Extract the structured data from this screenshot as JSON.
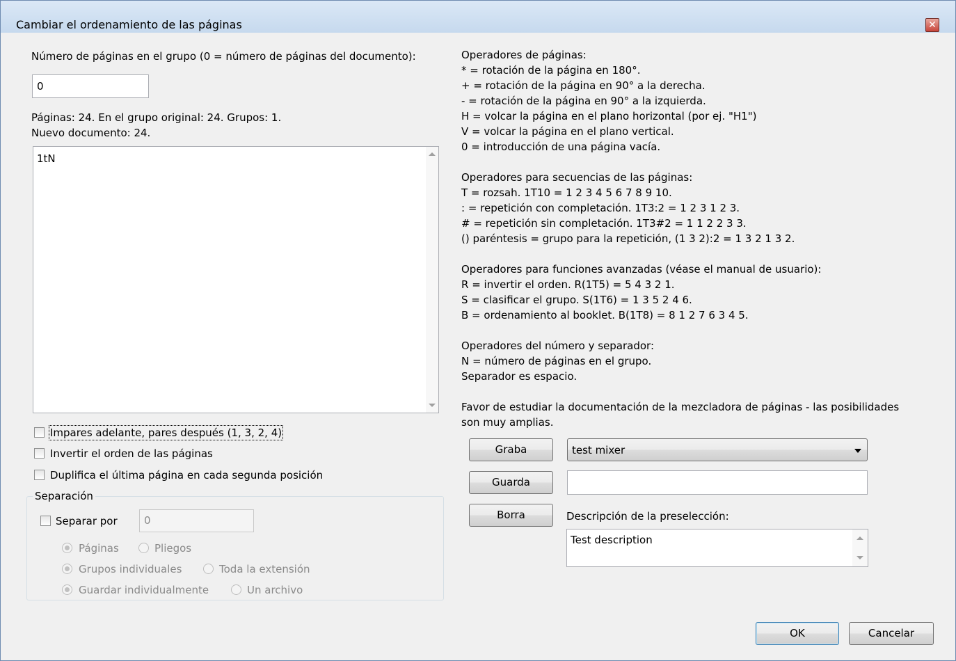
{
  "window": {
    "title": "Cambiar el ordenamiento de las páginas",
    "close_symbol": "✕"
  },
  "left": {
    "group_count_label": "Número de páginas en el grupo (0 = número de páginas del documento):",
    "group_count_value": "0",
    "stats_line1": "Páginas: 24. En el grupo original: 24. Grupos: 1.",
    "stats_line2": "Nuevo documento: 24.",
    "formula_value": "1tN",
    "checkbox_odd_even": "Impares adelante, pares después (1, 3, 2, 4)",
    "checkbox_reverse": "Invertir el orden de las páginas",
    "checkbox_duplicate": "Duplifica el última página en cada segunda posición",
    "separation": {
      "group_title": "Separación",
      "separate_by_label": "Separar por",
      "separate_by_value": "0",
      "radio_pages": "Páginas",
      "radio_sheets": "Pliegos",
      "radio_individual_groups": "Grupos individuales",
      "radio_whole_range": "Toda la extensión",
      "radio_save_individually": "Guardar individualmente",
      "radio_one_file": "Un archivo"
    }
  },
  "help": {
    "lines": [
      "Operadores de páginas:",
      "* = rotación de la página en 180°.",
      "+ = rotación de la página en 90° a la derecha.",
      "- = rotación de la página en 90° a la izquierda.",
      "H = volcar la página en el plano horizontal (por ej. \"H1\")",
      "V = volcar la página en el plano vertical.",
      "0 = introducción de una página vacía.",
      "",
      "Operadores para secuencias de las páginas:",
      "T = rozsah. 1T10 = 1 2 3 4 5 6 7 8 9 10.",
      ": = repetición con completación. 1T3:2 = 1 2 3 1 2 3.",
      "# = repetición sin completación. 1T3#2 = 1 1 2 2 3 3.",
      "() paréntesis = grupo para la repetición, (1 3 2):2 = 1 3 2 1 3 2.",
      "",
      "Operadores para funciones avanzadas (véase el manual de usuario):",
      "R = invertir el orden. R(1T5) = 5 4 3 2 1.",
      "S = clasificar el grupo. S(1T6) = 1 3 5 2 4 6.",
      "B = ordenamiento al booklet. B(1T8) = 8 1 2 7 6 3 4 5.",
      "",
      "Operadores del número y separador:",
      "N = número de páginas en el grupo.",
      "Separador es espacio.",
      "",
      "Favor de estudiar la documentación de la mezcladora de páginas  - las posibilidades",
      "son muy amplias."
    ]
  },
  "presets": {
    "save_button": "Graba",
    "store_button": "Guarda",
    "delete_button": "Borra",
    "selected_preset": "test mixer",
    "name_value": "",
    "description_label": "Descripción de la preselección:",
    "description_value": "Test description"
  },
  "footer": {
    "ok_button": "OK",
    "cancel_button": "Cancelar"
  }
}
